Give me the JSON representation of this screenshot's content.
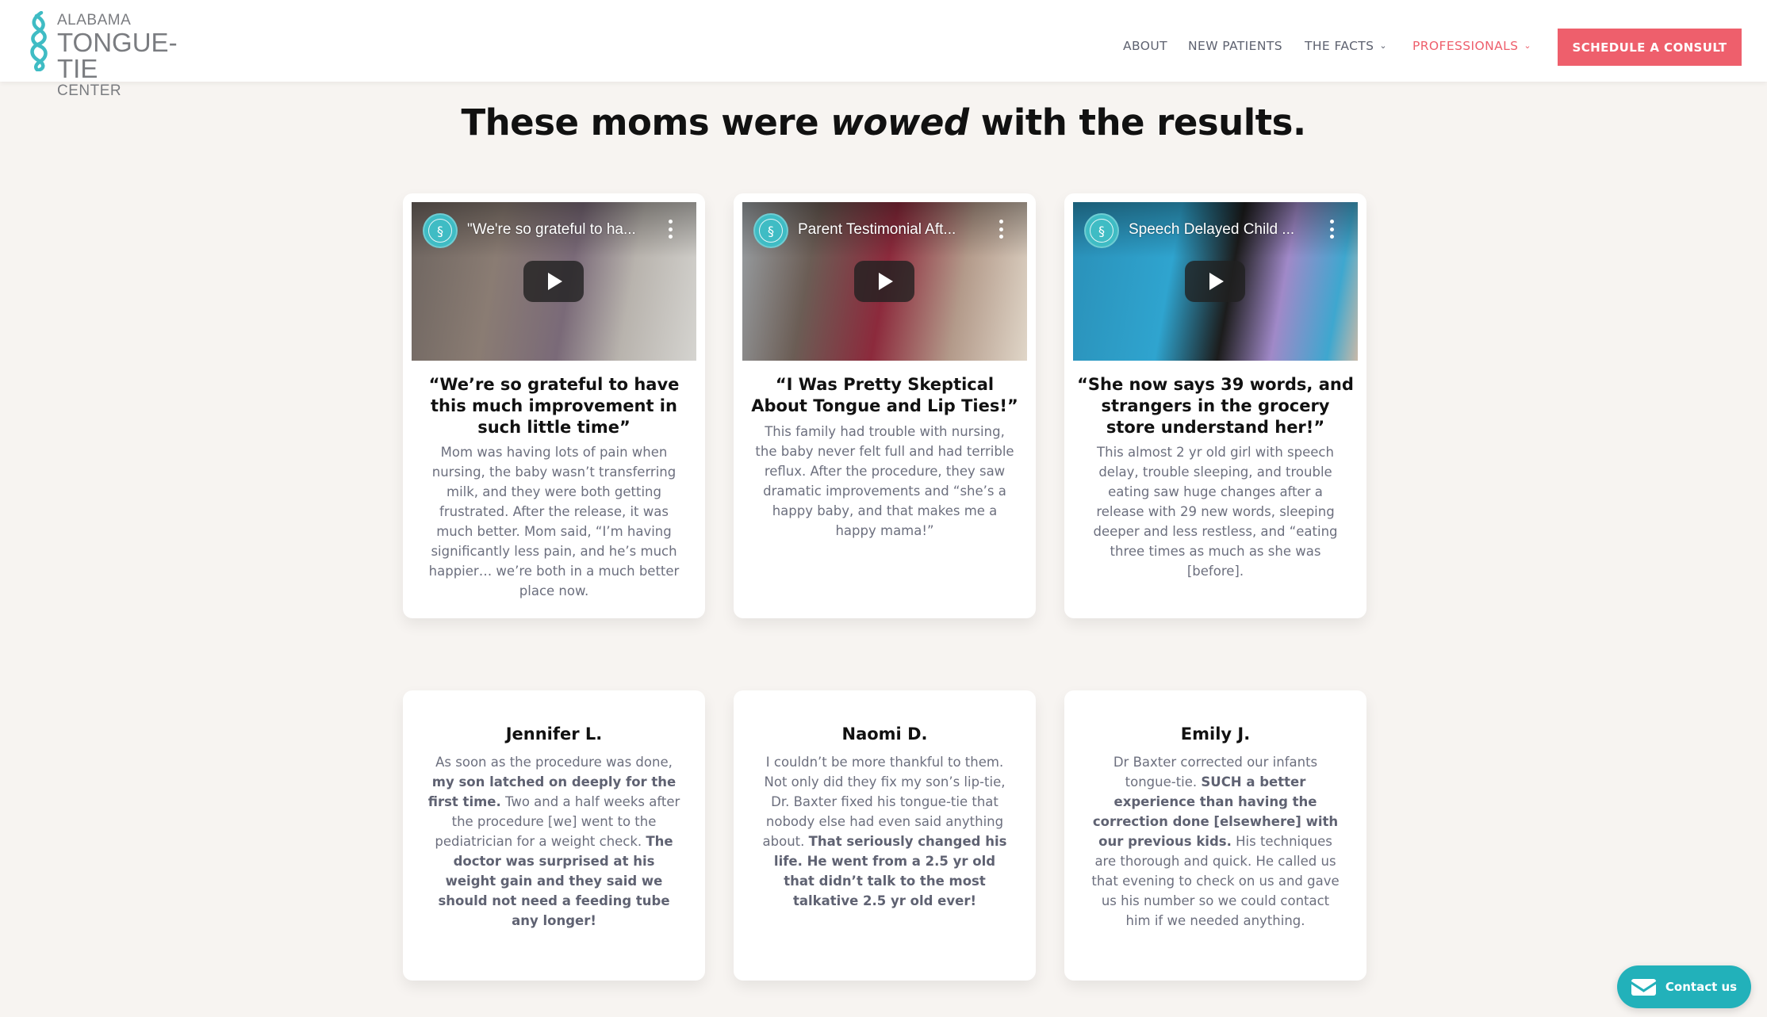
{
  "header": {
    "logo": {
      "line1": "ALABAMA",
      "line2": "TONGUE-TIE",
      "line3": "CENTER",
      "icon": "tongue-tie-knot-icon"
    },
    "nav": [
      {
        "label": "ABOUT",
        "dropdown": false,
        "active": false
      },
      {
        "label": "NEW PATIENTS",
        "dropdown": false,
        "active": false
      },
      {
        "label": "THE FACTS",
        "dropdown": true,
        "active": false
      },
      {
        "label": "PROFESSIONALS",
        "dropdown": true,
        "active": true
      }
    ],
    "chevron_glyph": "⌄",
    "cta_label": "SCHEDULE A CONSULT"
  },
  "headline": {
    "before": "These moms were ",
    "emphasis": "wowed",
    "after": " with the results."
  },
  "video_cards": [
    {
      "video_title": "\"We're so grateful to ha...",
      "title": "“We’re so grateful to have this much improvement in such little time”",
      "body": "Mom was having lots of pain when nursing, the baby wasn’t transferring milk, and they were both getting frustrated. After the release, it was much better. Mom said, “I’m having significantly less pain, and he’s much happier… we’re both in a much better place now."
    },
    {
      "video_title": "Parent Testimonial Aft...",
      "title": "“I Was Pretty Skeptical About Tongue and Lip Ties!”",
      "body": "This family had trouble with nursing, the baby never felt full and had terrible reflux. After the procedure, they saw dramatic improvements and “she’s a happy baby, and that makes me a happy mama!”"
    },
    {
      "video_title": "Speech Delayed Child ...",
      "title": "“She now says 39 words, and strangers in the grocery store understand her!”",
      "body": "This almost 2 yr old girl with speech delay, trouble sleeping, and trouble eating saw huge changes after a release with 29 new words, sleeping deeper and less restless, and “eating three times as much as she was [before]."
    }
  ],
  "reviews": [
    {
      "name": "Jennifer L.",
      "segments": [
        {
          "text": "As soon as the procedure was done, ",
          "bold": false
        },
        {
          "text": "my son latched on deeply for the first time.",
          "bold": true
        },
        {
          "text": " Two and a half weeks after the procedure [we] went to the pediatrician for a weight check. ",
          "bold": false
        },
        {
          "text": "The doctor was surprised at his weight gain and they said we should not need a feeding tube any longer!",
          "bold": true
        }
      ]
    },
    {
      "name": "Naomi D.",
      "segments": [
        {
          "text": "I couldn’t be more thankful to them. Not only did they fix my son’s lip-tie, Dr. Baxter fixed his tongue-tie that nobody else had even said anything about. ",
          "bold": false
        },
        {
          "text": "That seriously changed his life. He went from a 2.5 yr old that didn’t talk to the most talkative 2.5 yr old ever!",
          "bold": true
        }
      ]
    },
    {
      "name": "Emily J.",
      "segments": [
        {
          "text": "Dr Baxter corrected our infants tongue-tie. ",
          "bold": false
        },
        {
          "text": "SUCH a better experience than having the correction done [elsewhere] with our previous kids.",
          "bold": true
        },
        {
          "text": " His techniques are thorough and quick. He called us that evening to check on us and gave us his number so we could contact him if we needed anything.",
          "bold": false
        }
      ]
    }
  ],
  "contact_button": {
    "label": "Contact us",
    "icon": "mail-icon"
  },
  "colors": {
    "accent_coral": "#ee5f6c",
    "accent_teal": "#22b1ba",
    "logo_teal": "#3fbcc4",
    "page_bg": "#f7f4f1",
    "body_text": "#6c6f7e"
  }
}
